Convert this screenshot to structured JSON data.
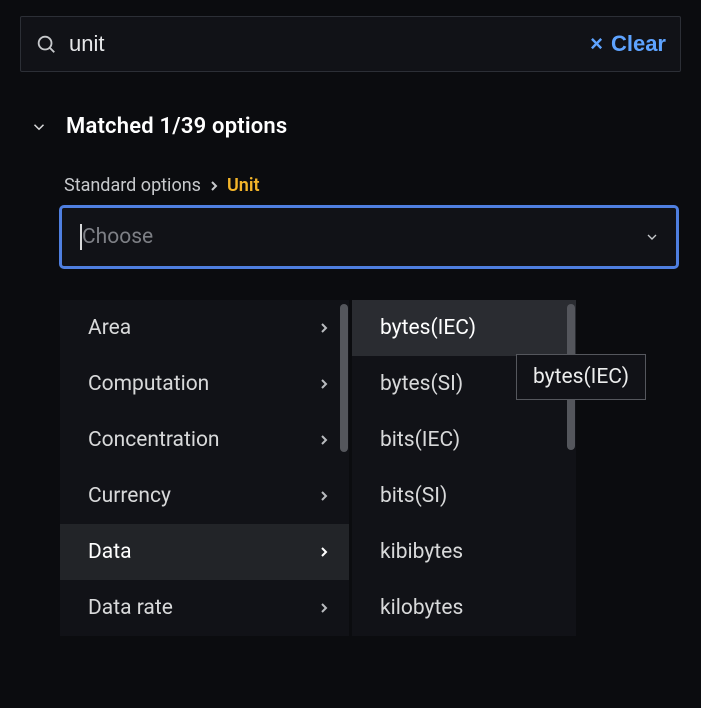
{
  "search": {
    "value": "unit",
    "clear_label": "Clear"
  },
  "matched": {
    "title": "Matched 1/39 options"
  },
  "breadcrumb": {
    "parent": "Standard options",
    "current": "Unit"
  },
  "choose": {
    "placeholder": "Choose"
  },
  "primary_panel": {
    "items": [
      {
        "label": "Area",
        "selected": false
      },
      {
        "label": "Computation",
        "selected": false
      },
      {
        "label": "Concentration",
        "selected": false
      },
      {
        "label": "Currency",
        "selected": false
      },
      {
        "label": "Data",
        "selected": true
      },
      {
        "label": "Data rate",
        "selected": false
      }
    ]
  },
  "secondary_panel": {
    "items": [
      {
        "label": "bytes(IEC)",
        "hovered": true
      },
      {
        "label": "bytes(SI)",
        "hovered": false
      },
      {
        "label": "bits(IEC)",
        "hovered": false
      },
      {
        "label": "bits(SI)",
        "hovered": false
      },
      {
        "label": "kibibytes",
        "hovered": false
      },
      {
        "label": "kilobytes",
        "hovered": false
      }
    ]
  },
  "tooltip": {
    "text": "bytes(IEC)"
  }
}
